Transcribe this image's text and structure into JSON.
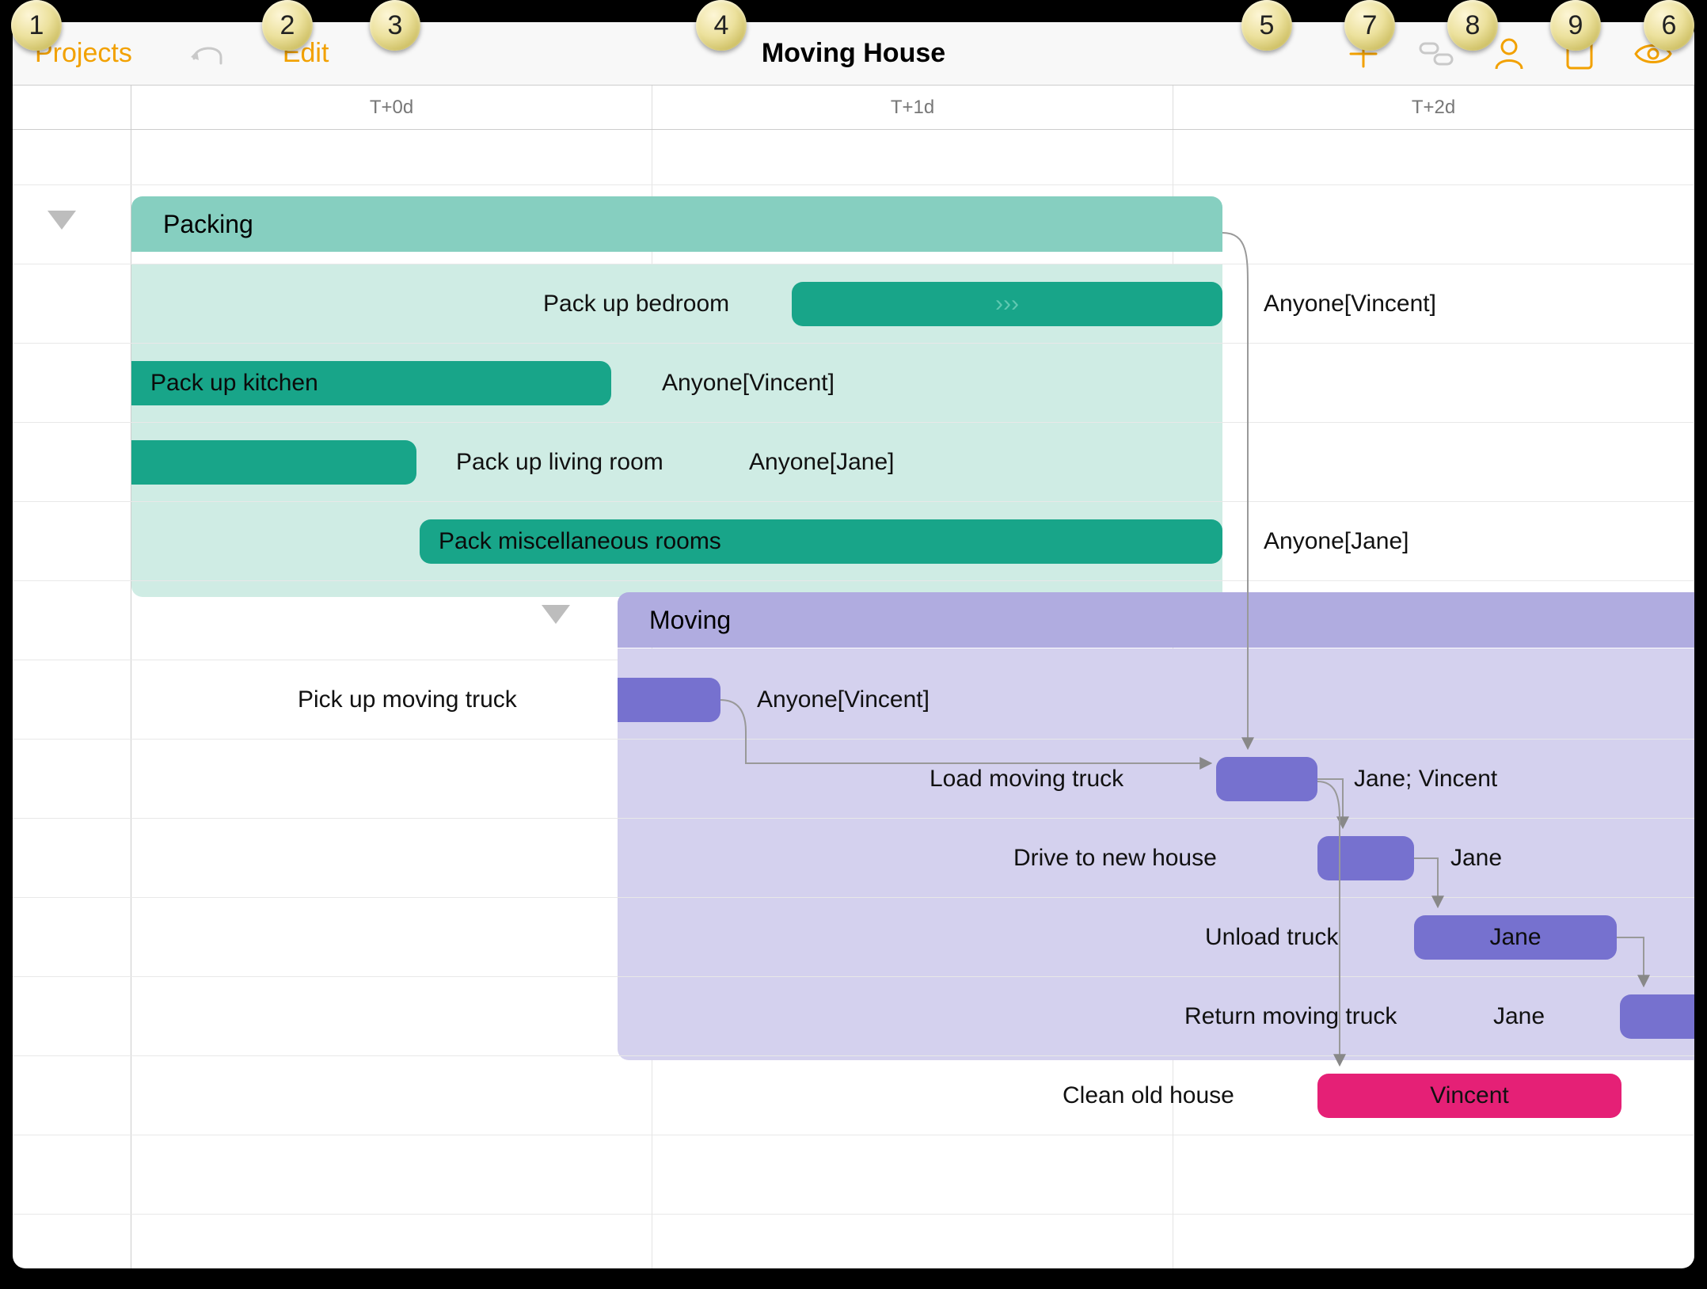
{
  "toolbar": {
    "projects": "Projects",
    "edit": "Edit",
    "title": "Moving House"
  },
  "timeline": {
    "columns": [
      "T+0d",
      "T+1d",
      "T+2d"
    ]
  },
  "groups": {
    "packing": {
      "label": "Packing"
    },
    "moving": {
      "label": "Moving"
    }
  },
  "tasks": {
    "pack_bedroom": {
      "label": "Pack up bedroom",
      "assignee": "Anyone[Vincent]"
    },
    "pack_kitchen": {
      "label": "Pack up kitchen",
      "assignee": "Anyone[Vincent]"
    },
    "pack_living": {
      "label": "Pack up living room",
      "assignee": "Anyone[Jane]"
    },
    "pack_misc": {
      "label": "Pack miscellaneous rooms",
      "assignee": "Anyone[Jane]"
    },
    "pickup_truck": {
      "label": "Pick up moving truck",
      "assignee": "Anyone[Vincent]"
    },
    "load_truck": {
      "label": "Load moving truck",
      "assignee": "Jane; Vincent"
    },
    "drive": {
      "label": "Drive to new house",
      "assignee": "Jane"
    },
    "unload": {
      "label": "Unload truck",
      "assignee": "Jane"
    },
    "return_truck": {
      "label": "Return moving truck",
      "assignee": "Jane"
    },
    "clean": {
      "label": "Clean old house",
      "assignee": "Vincent"
    }
  },
  "callouts": [
    "1",
    "2",
    "3",
    "4",
    "5",
    "7",
    "8",
    "9",
    "6"
  ],
  "colors": {
    "accent": "#f2a100",
    "teal_dark": "#18a589",
    "teal_light": "#b4e4da",
    "teal_header": "#86cfc0",
    "purple_dark": "#7671cf",
    "purple_light": "#c6c2ea",
    "purple_header": "#adaae0",
    "pink": "#e52076"
  }
}
